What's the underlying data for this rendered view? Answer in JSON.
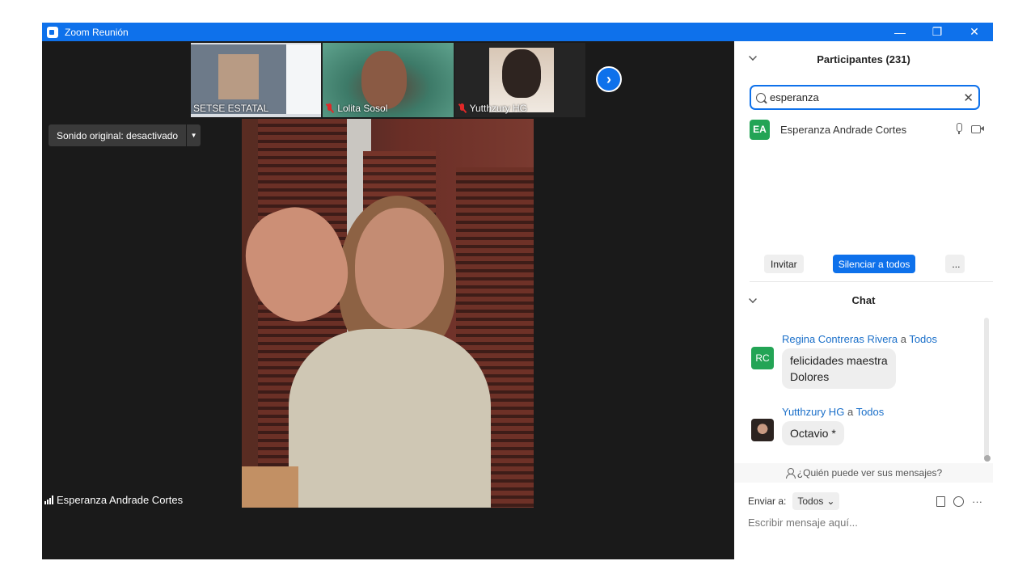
{
  "window": {
    "title": "Zoom Reunión",
    "minimize_symbol": "—",
    "restore_symbol": "❐",
    "close_symbol": "✕"
  },
  "video": {
    "thumbnails": [
      {
        "name": "SETSE ESTATAL",
        "muted": false
      },
      {
        "name": "Lolita Sosol",
        "muted": true
      },
      {
        "name": "Yutthzury HG",
        "muted": true
      }
    ],
    "next_symbol": "›",
    "original_sound_label": "Sonido original: desactivado",
    "original_sound_caret": "▼",
    "active_speaker": "Esperanza Andrade Cortes"
  },
  "participants": {
    "header": "Participantes (231)",
    "search_value": "esperanza",
    "clear_symbol": "✕",
    "list": [
      {
        "initials": "EA",
        "name": "Esperanza Andrade Cortes"
      }
    ],
    "invite_label": "Invitar",
    "mute_all_label": "Silenciar a todos",
    "more_label": "..."
  },
  "chat": {
    "header": "Chat",
    "messages": [
      {
        "sender": "Regina Contreras Rivera",
        "connector": "a",
        "recipient": "Todos",
        "avatar_initials": "RC",
        "lines": [
          "felicidades maestra",
          "Dolores"
        ]
      },
      {
        "sender": "Yutthzury HG",
        "connector": "a",
        "recipient": "Todos",
        "lines": [
          "Octavio *"
        ]
      }
    ],
    "who_can_see": "¿Quién puede ver sus mensajes?",
    "send_to_label": "Enviar a:",
    "send_to_value": "Todos",
    "send_to_caret": "⌄",
    "more_symbol": "···",
    "input_placeholder": "Escribir mensaje aquí..."
  },
  "colors": {
    "accent": "#0e71eb",
    "avatar_green": "#23a455",
    "video_bg": "#1a1a1a"
  }
}
